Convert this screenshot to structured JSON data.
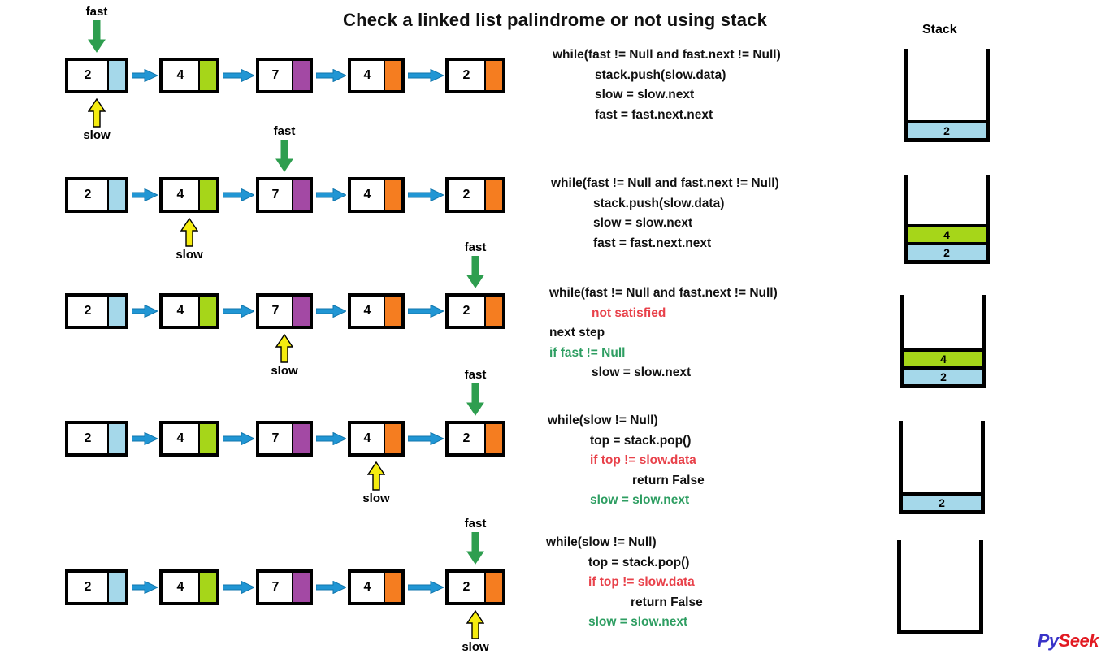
{
  "title": "Check a linked list palindrome or not using stack",
  "colors": {
    "node_border": "#000000",
    "link_arrow": "#2196d4",
    "fast_arrow": "#2e9e4f",
    "slow_arrow": "#f5ec0f",
    "red_text": "#e8414a",
    "green_text": "#2e9e62",
    "ptr_blue": "#a5d8ea",
    "ptr_green": "#a6d619",
    "ptr_purple": "#a349a4",
    "ptr_orange": "#f57d20"
  },
  "list": {
    "values": [
      "2",
      "4",
      "7",
      "4",
      "2"
    ],
    "pointer_colors": [
      "#a5d8ea",
      "#a6d619",
      "#a349a4",
      "#f57d20",
      "#f57d20"
    ]
  },
  "marker_labels": {
    "fast": "fast",
    "slow": "slow"
  },
  "rows": [
    {
      "fast_index": 0,
      "slow_index": 0
    },
    {
      "fast_index": 2,
      "slow_index": 1
    },
    {
      "fast_index": 4,
      "slow_index": 2
    },
    {
      "fast_index": 4,
      "slow_index": 3
    },
    {
      "fast_index": 4,
      "slow_index": 4
    }
  ],
  "code_blocks": [
    {
      "lines": [
        {
          "text": "while(fast != Null and fast.next != Null)",
          "color": "black",
          "indent": 0
        },
        {
          "text": "stack.push(slow.data)",
          "color": "black",
          "indent": 1
        },
        {
          "text": "slow = slow.next",
          "color": "black",
          "indent": 1
        },
        {
          "text": "fast = fast.next.next",
          "color": "black",
          "indent": 1
        }
      ]
    },
    {
      "lines": [
        {
          "text": "while(fast != Null and fast.next != Null)",
          "color": "black",
          "indent": 0
        },
        {
          "text": "stack.push(slow.data)",
          "color": "black",
          "indent": 1
        },
        {
          "text": "slow = slow.next",
          "color": "black",
          "indent": 1
        },
        {
          "text": "fast = fast.next.next",
          "color": "black",
          "indent": 1
        }
      ]
    },
    {
      "lines": [
        {
          "text": "while(fast != Null and fast.next != Null)",
          "color": "black",
          "indent": 0
        },
        {
          "text": "not satisfied",
          "color": "red",
          "indent": 1
        },
        {
          "text": "next step",
          "color": "black",
          "indent": 0
        },
        {
          "text": "if fast != Null",
          "color": "green",
          "indent": 0
        },
        {
          "text": "slow = slow.next",
          "color": "black",
          "indent": 1
        }
      ]
    },
    {
      "lines": [
        {
          "text": "while(slow != Null)",
          "color": "black",
          "indent": 0
        },
        {
          "text": "top = stack.pop()",
          "color": "black",
          "indent": 1
        },
        {
          "text": "if top != slow.data",
          "color": "red",
          "indent": 1
        },
        {
          "text": "return False",
          "color": "black",
          "indent": 2
        },
        {
          "text": "slow = slow.next",
          "color": "green",
          "indent": 1
        }
      ]
    },
    {
      "lines": [
        {
          "text": "while(slow != Null)",
          "color": "black",
          "indent": 0
        },
        {
          "text": "top = stack.pop()",
          "color": "black",
          "indent": 1
        },
        {
          "text": "if top != slow.data",
          "color": "red",
          "indent": 1
        },
        {
          "text": "return False",
          "color": "black",
          "indent": 2
        },
        {
          "text": "slow = slow.next",
          "color": "green",
          "indent": 1
        }
      ]
    }
  ],
  "stack_panel": {
    "heading": "Stack",
    "stacks": [
      {
        "cells": [
          {
            "value": "2",
            "color": "#a5d8ea"
          }
        ]
      },
      {
        "cells": [
          {
            "value": "4",
            "color": "#a6d619"
          },
          {
            "value": "2",
            "color": "#a5d8ea"
          }
        ]
      },
      {
        "cells": [
          {
            "value": "4",
            "color": "#a6d619"
          },
          {
            "value": "2",
            "color": "#a5d8ea"
          }
        ]
      },
      {
        "cells": [
          {
            "value": "2",
            "color": "#a5d8ea"
          }
        ]
      },
      {
        "cells": []
      }
    ]
  },
  "logo": {
    "part1": "Py",
    "part2": "Seek"
  }
}
